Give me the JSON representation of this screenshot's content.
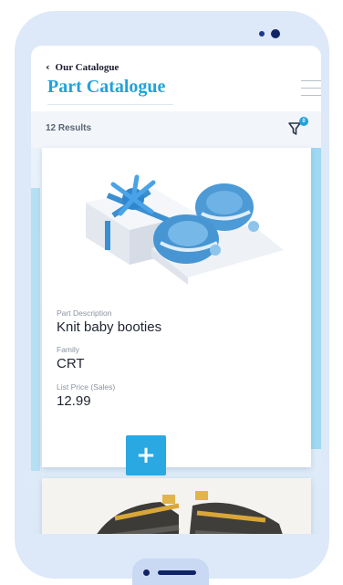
{
  "header": {
    "back_label": "Our Catalogue",
    "back_icon": "chevron-left-icon",
    "title": "Part Catalogue",
    "menu_icon": "hamburger-menu-icon"
  },
  "results": {
    "count_label": "12 Results",
    "filter_icon": "filter-icon",
    "filter_badge": "0"
  },
  "products": [
    {
      "image": "knit-baby-booties-photo",
      "description_label": "Part Description",
      "description": "Knit baby booties",
      "family_label": "Family",
      "family": "CRT",
      "price_label": "List Price (Sales)",
      "price": "12.99"
    },
    {
      "image": "baby-sandals-photo"
    }
  ],
  "fab": {
    "label": "+",
    "icon": "plus-icon"
  },
  "colors": {
    "accent": "#1fa3dc",
    "phone_frame": "#dde8f8",
    "dark_navy": "#0f2466"
  }
}
